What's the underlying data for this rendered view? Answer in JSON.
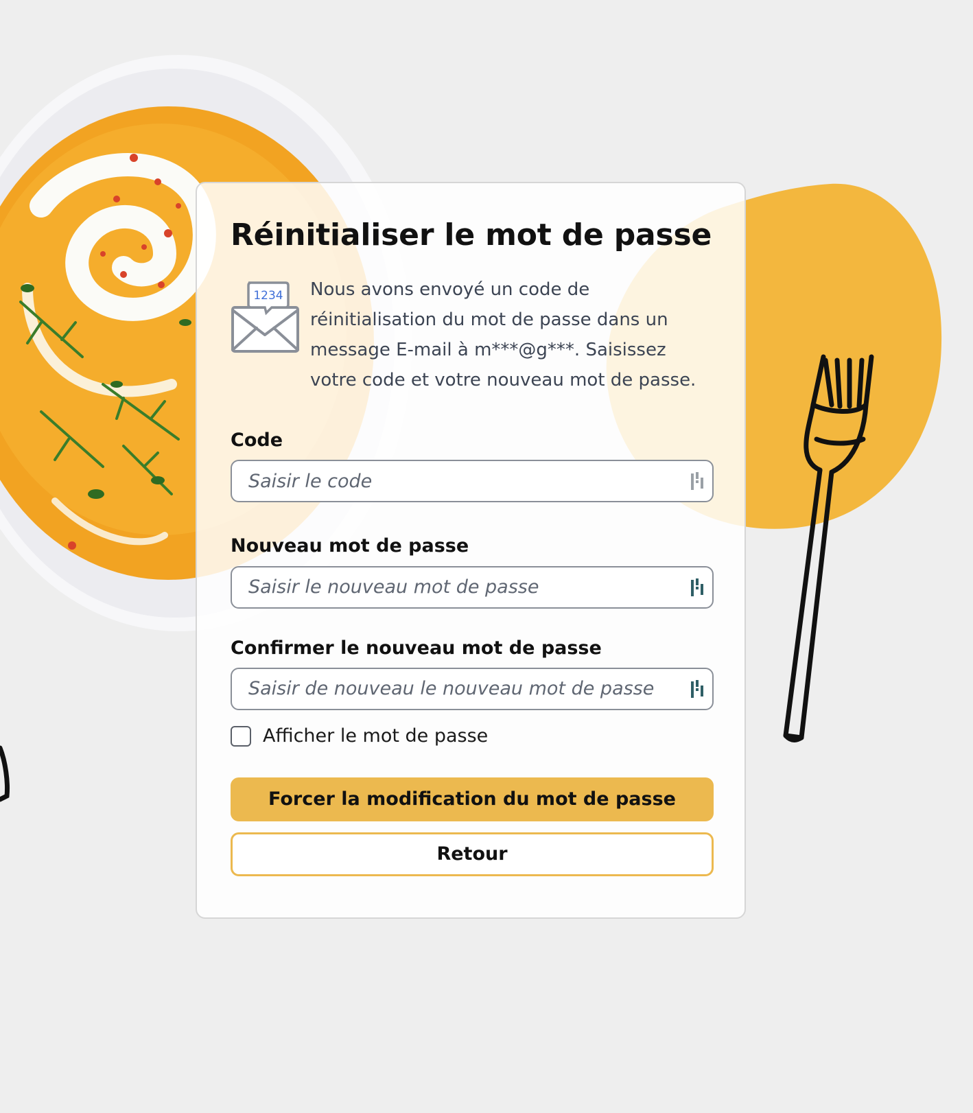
{
  "page": {
    "title": "Réinitialiser le mot de passe",
    "info_text": "Nous avons envoyé un code de réinitialisation du mot de passe dans un message E-mail à m***@g***. Saisissez votre code et votre nouveau mot de passe.",
    "envelope_code": "1234"
  },
  "form": {
    "code_label": "Code",
    "code_placeholder": "Saisir le code",
    "new_password_label": "Nouveau mot de passe",
    "new_password_placeholder": "Saisir le nouveau mot de passe",
    "confirm_password_label": "Confirmer le nouveau mot de passe",
    "confirm_password_placeholder": "Saisir de nouveau le nouveau mot de passe",
    "show_password_label": "Afficher le mot de passe",
    "show_password_checked": false,
    "submit_label": "Forcer la modification du mot de passe",
    "back_label": "Retour"
  },
  "colors": {
    "accent": "#ecb94f",
    "background": "#eeeeee",
    "title_text": "#111111",
    "body_text": "#3c4453"
  },
  "icons": {
    "envelope": "envelope-code-icon",
    "password_manager": "password-manager-icon",
    "fork": "fork-icon"
  }
}
